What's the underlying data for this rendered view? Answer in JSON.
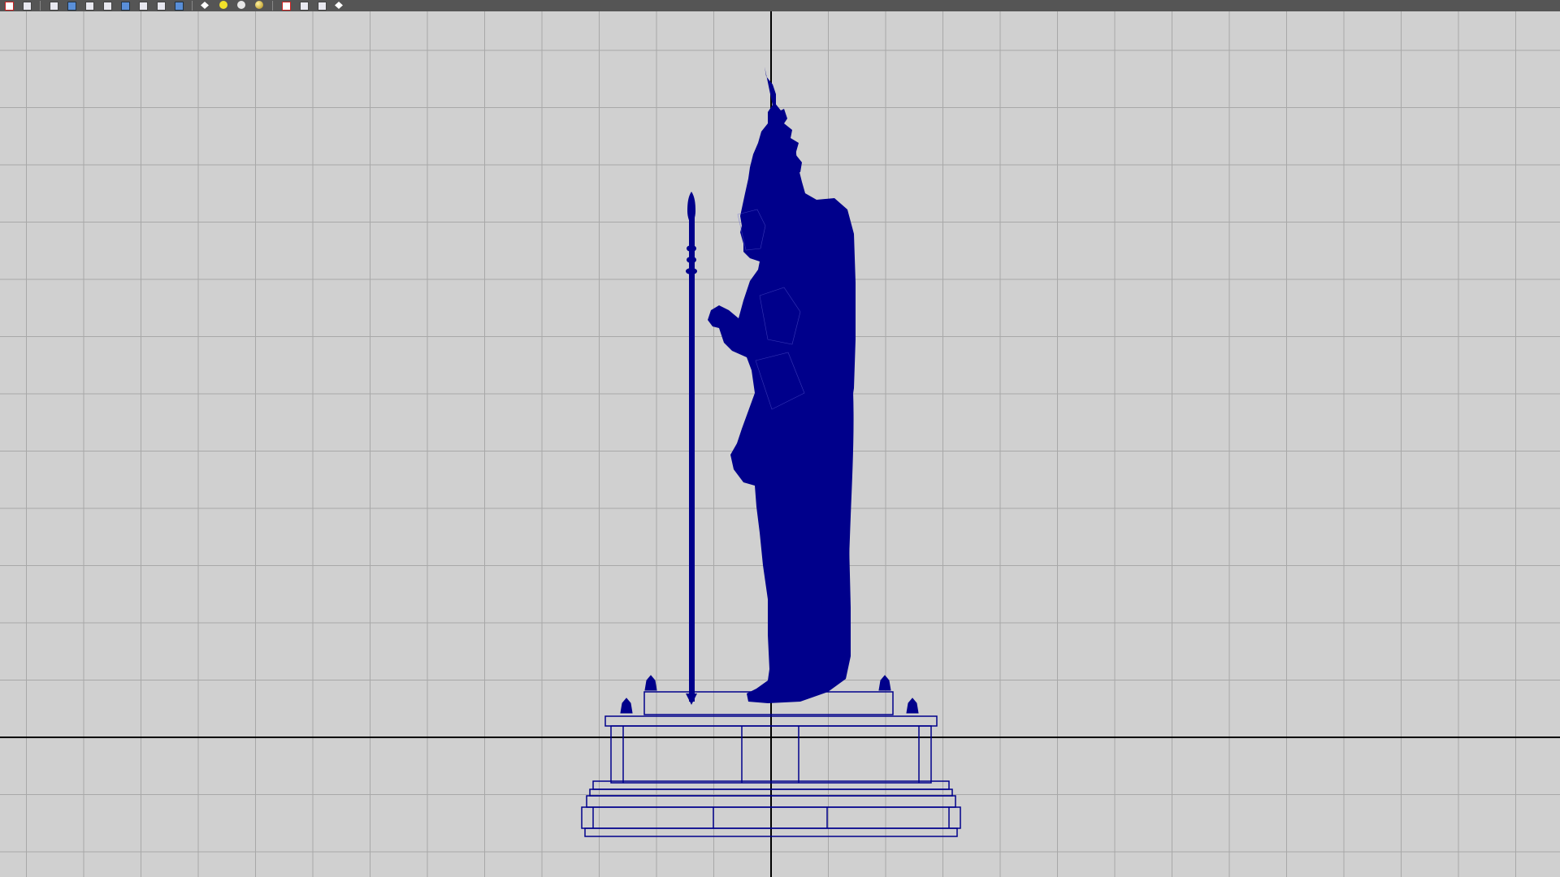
{
  "toolbar": {
    "buttons": [
      {
        "name": "select-tool-icon",
        "style": "red"
      },
      {
        "name": "lasso-icon",
        "style": "cube"
      },
      {
        "name": "grid-snap-icon",
        "style": "cube"
      },
      {
        "name": "curve-snap-icon",
        "style": "blue"
      },
      {
        "name": "point-snap-icon",
        "style": "cube"
      },
      {
        "name": "view-plane-snap-icon",
        "style": "cube"
      },
      {
        "name": "render-region-icon",
        "style": "blue"
      },
      {
        "name": "render-icon",
        "style": "cube"
      },
      {
        "name": "ipr-render-icon",
        "style": "cube"
      },
      {
        "name": "render-settings-icon",
        "style": "blue"
      },
      {
        "name": "hypershade-icon",
        "style": "node"
      },
      {
        "name": "light-yellow-icon",
        "style": "sphere-y"
      },
      {
        "name": "light-white-icon",
        "style": "sphere-w"
      },
      {
        "name": "shaded-sphere-icon",
        "style": "sphere-g"
      },
      {
        "name": "xray-icon",
        "style": "red"
      },
      {
        "name": "camera-icon",
        "style": "cube"
      },
      {
        "name": "panel-layout-icon",
        "style": "cube"
      },
      {
        "name": "node-editor-icon",
        "style": "node"
      }
    ]
  },
  "viewport": {
    "background_color": "#d0d0d0",
    "grid_color": "#a8a8a8",
    "axis_color": "#000000",
    "wireframe_color": "#00008b",
    "object": "statue-wireframe"
  }
}
